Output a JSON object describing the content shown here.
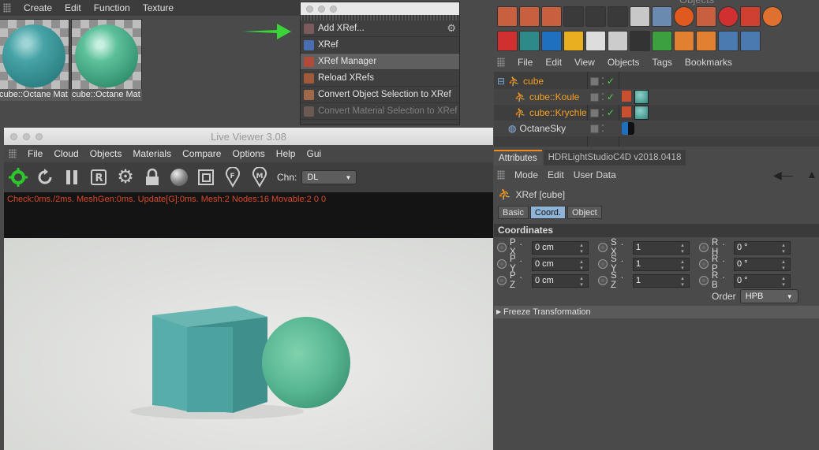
{
  "material_manager": {
    "menu": [
      "Create",
      "Edit",
      "Function",
      "Texture"
    ],
    "materials": [
      {
        "label": "cube::Octane Mat",
        "color": "#3f9a9c"
      },
      {
        "label": "cube::Octane Mat",
        "color": "#44b08a"
      }
    ]
  },
  "popup": {
    "items": [
      {
        "label": "Add XRef...",
        "state": "normal"
      },
      {
        "label": "XRef",
        "state": "normal"
      },
      {
        "label": "XRef Manager",
        "state": "highlighted"
      },
      {
        "label": "Reload XRefs",
        "state": "normal"
      },
      {
        "label": "Convert Object Selection to XRef",
        "state": "normal"
      },
      {
        "label": "Convert Material Selection to XRef",
        "state": "disabled"
      }
    ]
  },
  "live_viewer": {
    "title": "Live Viewer 3.08",
    "menu": [
      "File",
      "Cloud",
      "Objects",
      "Materials",
      "Compare",
      "Options",
      "Help",
      "Gui"
    ],
    "channel_label": "Chn:",
    "channel_value": "DL",
    "status": "Check:0ms./2ms. MeshGen:0ms. Update[G]:0ms. Mesh:2 Nodes:16 Movable:2  0 0",
    "toolbar_icons": [
      "octane-icon",
      "refresh-icon",
      "pause-icon",
      "r-icon",
      "settings-gear-icon",
      "lock-icon",
      "material-ball-icon",
      "region-icon",
      "pin-f-icon",
      "pin-m-icon"
    ]
  },
  "object_manager": {
    "menu": [
      "File",
      "Edit",
      "View",
      "Objects",
      "Tags",
      "Bookmarks"
    ],
    "objects": [
      {
        "name": "cube",
        "indent": 0,
        "highlight": true
      },
      {
        "name": "cube::Koule",
        "indent": 1,
        "highlight": true
      },
      {
        "name": "cube::Krychle",
        "indent": 1,
        "highlight": true
      },
      {
        "name": "OctaneSky",
        "indent": 0,
        "highlight": false
      }
    ]
  },
  "attributes": {
    "tabs": [
      "Attributes",
      "HDRLightStudioC4D v2018.0418"
    ],
    "menu": [
      "Mode",
      "Edit",
      "User Data"
    ],
    "object_title": "XRef [cube]",
    "subtabs": [
      "Basic",
      "Coord.",
      "Object"
    ],
    "section": "Coordinates",
    "rows": [
      [
        {
          "label": "P . X",
          "value": "0 cm"
        },
        {
          "label": "S . X",
          "value": "1"
        },
        {
          "label": "R . H",
          "value": "0 °"
        }
      ],
      [
        {
          "label": "P . Y",
          "value": "0 cm"
        },
        {
          "label": "S . Y",
          "value": "1"
        },
        {
          "label": "R . P",
          "value": "0 °"
        }
      ],
      [
        {
          "label": "P . Z",
          "value": "0 cm"
        },
        {
          "label": "S . Z",
          "value": "1"
        },
        {
          "label": "R . B",
          "value": "0 °"
        }
      ]
    ],
    "order_label": "Order",
    "order_value": "HPB",
    "freeze": "Freeze Transformation"
  },
  "colors": {
    "accent": "#f08a20",
    "status_text": "#d94a2a",
    "arrow": "#3ad43a"
  }
}
